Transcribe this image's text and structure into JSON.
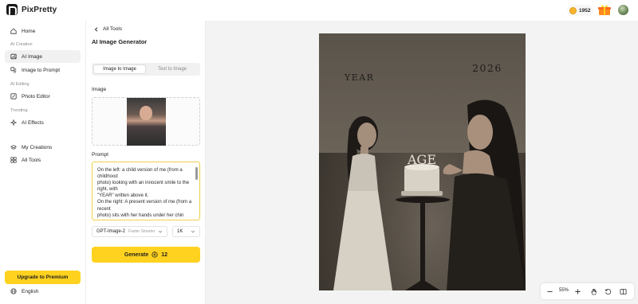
{
  "app": {
    "name": "PixPretty"
  },
  "header": {
    "credits": "1952"
  },
  "sidebar": {
    "home": "Home",
    "section_creation": "AI Creation",
    "ai_image": "AI Image",
    "image_to_prompt": "Image to Prompt",
    "section_editing": "AI Editing",
    "photo_editor": "Photo Editor",
    "section_trending": "Trending",
    "ai_effects": "AI Effects",
    "my_creations": "My Creations",
    "all_tools": "All Tools",
    "upgrade": "Upgrade to Premium",
    "language": "English"
  },
  "panel": {
    "back": "All Tools",
    "title": "AI Image Generator",
    "tabs": [
      "Image to Image",
      "Text to Image"
    ],
    "image_label": "Image",
    "prompt_label": "Prompt",
    "prompt_value": "On the left: a child version of me (from a childhood\nphoto) looking with an innocent smile to the right, with\n\"YEAR\" written above it.\nOn the right: A present version of me (from a recent\nphoto) sits with her hands under her chin",
    "model": "GPT-Image-2",
    "model_tags": "Faster Smarter",
    "resolution": "1K",
    "generate": "Generate",
    "generate_cost": "12"
  },
  "canvas": {
    "photo_text_left": "YEAR",
    "photo_text_right": "2026",
    "cake_text": "AGE",
    "zoom": "55%"
  },
  "colors": {
    "accent": "#ffd21f",
    "coin": "#f7b52c"
  }
}
